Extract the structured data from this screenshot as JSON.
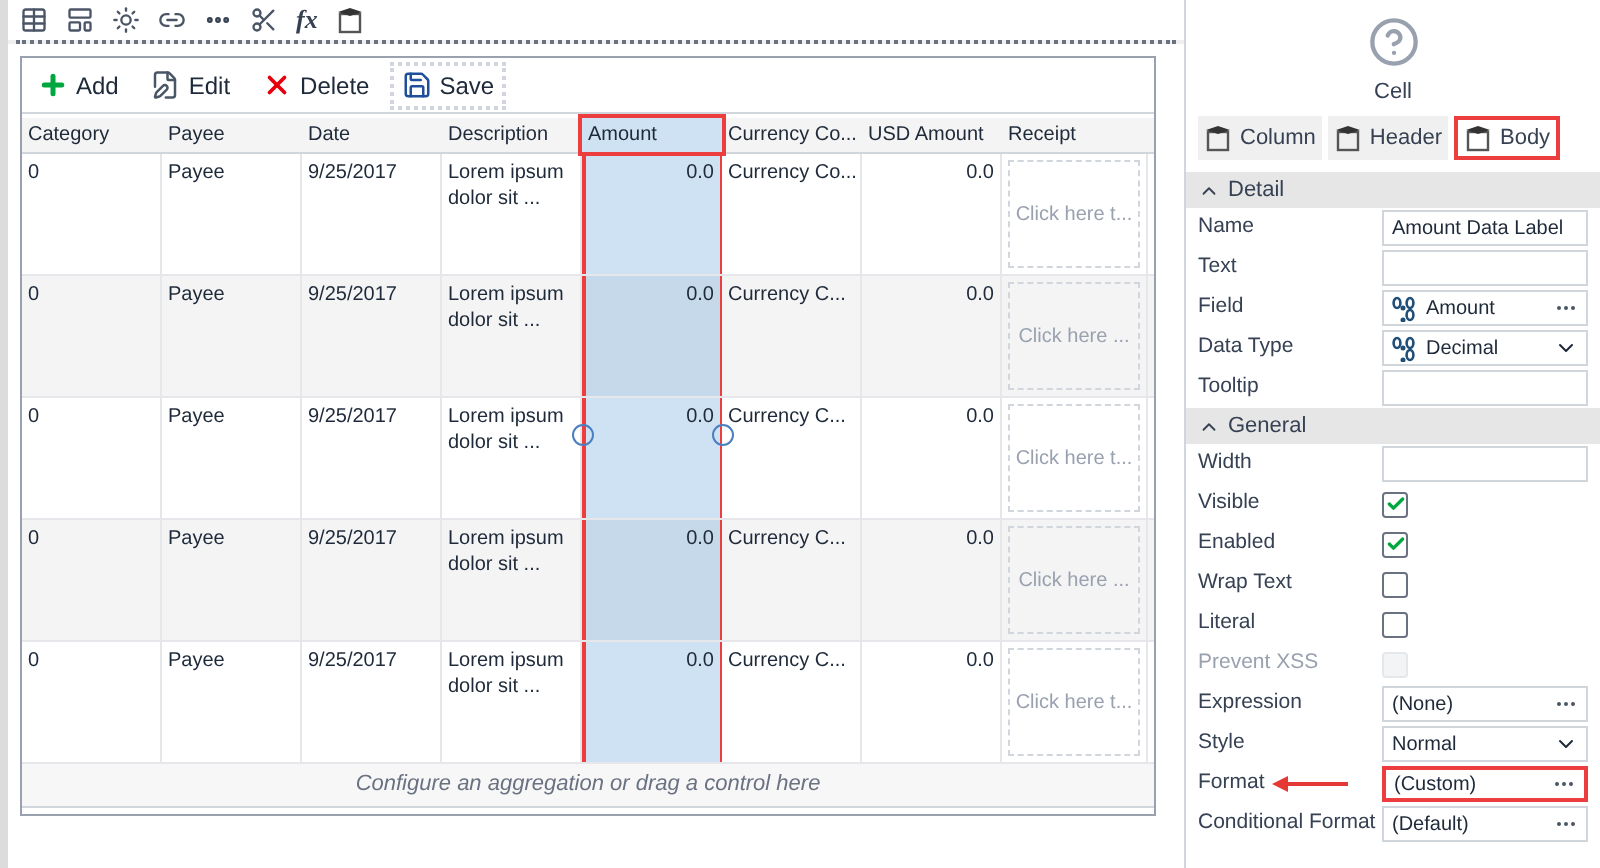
{
  "designer_toolbar": {
    "formula_label": "fx"
  },
  "grid_toolbar": [
    {
      "kind": "add",
      "label": "Add",
      "selected": false
    },
    {
      "kind": "edit",
      "label": "Edit",
      "selected": false
    },
    {
      "kind": "delete",
      "label": "Delete",
      "selected": false
    },
    {
      "kind": "save",
      "label": "Save",
      "selected": true
    }
  ],
  "table": {
    "columns": [
      {
        "label": "Category",
        "selected": false
      },
      {
        "label": "Payee",
        "selected": false
      },
      {
        "label": "Date",
        "selected": false
      },
      {
        "label": "Description",
        "selected": false
      },
      {
        "label": "Amount",
        "selected": true
      },
      {
        "label": "Currency Co...",
        "selected": false
      },
      {
        "label": "USD Amount",
        "selected": false
      },
      {
        "label": "Receipt",
        "selected": false
      }
    ],
    "rows": [
      {
        "cells": [
          "0",
          "Payee",
          "9/25/2017",
          "Lorem ipsum dolor sit ...",
          "0.0",
          "Currency Co...",
          "0.0",
          "Click here t..."
        ],
        "handles": false
      },
      {
        "cells": [
          "0",
          "Payee",
          "9/25/2017",
          "Lorem ipsum dolor sit ...",
          "0.0",
          "Currency C...",
          "0.0",
          "Click here ..."
        ],
        "handles": false
      },
      {
        "cells": [
          "0",
          "Payee",
          "9/25/2017",
          "Lorem ipsum dolor sit ...",
          "0.0",
          "Currency C...",
          "0.0",
          "Click here t..."
        ],
        "handles": true
      },
      {
        "cells": [
          "0",
          "Payee",
          "9/25/2017",
          "Lorem ipsum dolor sit ...",
          "0.0",
          "Currency C...",
          "0.0",
          "Click here ..."
        ],
        "handles": false
      },
      {
        "cells": [
          "0",
          "Payee",
          "9/25/2017",
          "Lorem ipsum dolor sit ...",
          "0.0",
          "Currency C...",
          "0.0",
          "Click here t..."
        ],
        "handles": false
      }
    ],
    "footer": "Configure an aggregation or drag a control here"
  },
  "properties_panel": {
    "title": "Cell",
    "tabs": [
      {
        "label": "Column",
        "selected": false
      },
      {
        "label": "Header",
        "selected": false
      },
      {
        "label": "Body",
        "selected": true
      }
    ],
    "sections": [
      {
        "title": "Detail",
        "expanded": true,
        "properties": [
          {
            "kind": "text",
            "label": "Name",
            "value": "Amount Data Label"
          },
          {
            "kind": "text",
            "label": "Text"
          },
          {
            "kind": "field",
            "label": "Field",
            "value": "Amount"
          },
          {
            "kind": "dropdown_typed",
            "label": "Data Type",
            "value": "Decimal"
          },
          {
            "kind": "text",
            "label": "Tooltip"
          }
        ]
      },
      {
        "title": "General",
        "expanded": true,
        "properties": [
          {
            "kind": "text",
            "label": "Width"
          },
          {
            "kind": "checkbox",
            "label": "Visible",
            "checked": true,
            "disabled": false
          },
          {
            "kind": "checkbox",
            "label": "Enabled",
            "checked": true,
            "disabled": false
          },
          {
            "kind": "checkbox",
            "label": "Wrap Text",
            "checked": false,
            "disabled": false
          },
          {
            "kind": "checkbox",
            "label": "Literal",
            "checked": false,
            "disabled": false
          },
          {
            "kind": "checkbox",
            "label": "Prevent XSS",
            "checked": false,
            "disabled": true
          },
          {
            "kind": "ellipsis",
            "label": "Expression",
            "value": "(None)",
            "highlighted": false
          },
          {
            "kind": "dropdown",
            "label": "Style",
            "value": "Normal"
          },
          {
            "kind": "ellipsis",
            "label": "Format",
            "value": "(Custom)",
            "highlighted": true
          },
          {
            "kind": "ellipsis",
            "label": "Conditional Format",
            "value": "(Default)",
            "highlighted": false
          }
        ]
      }
    ]
  }
}
